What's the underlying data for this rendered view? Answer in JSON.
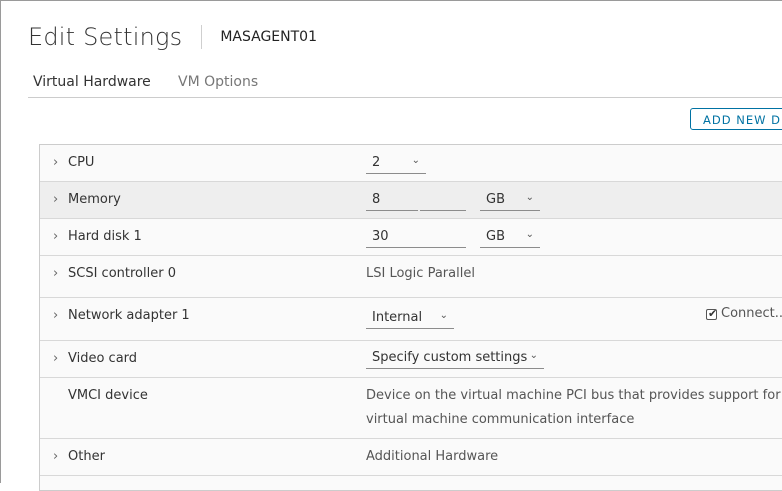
{
  "header": {
    "title": "Edit Settings",
    "vm_name": "MASAGENT01"
  },
  "tabs": [
    {
      "label": "Virtual Hardware",
      "active": true
    },
    {
      "label": "VM Options",
      "active": false
    }
  ],
  "toolbar": {
    "add_new_device_label": "ADD NEW DEVICE"
  },
  "hardware": {
    "cpu": {
      "label": "CPU",
      "value": "2"
    },
    "memory": {
      "label": "Memory",
      "value": "8",
      "unit": "GB"
    },
    "hard_disk": {
      "label": "Hard disk 1",
      "value": "30",
      "unit": "GB"
    },
    "scsi": {
      "label": "SCSI controller 0",
      "value": "LSI Logic Parallel"
    },
    "network": {
      "label": "Network adapter 1",
      "value": "Internal",
      "connect_label": "Connect...",
      "connected": true
    },
    "video": {
      "label": "Video card",
      "value": "Specify custom settings"
    },
    "vmci": {
      "label": "VMCI device",
      "description_line1": "Device on the virtual machine PCI bus that provides support for the",
      "description_line2": "virtual machine communication interface"
    },
    "other": {
      "label": "Other",
      "value": "Additional Hardware"
    }
  },
  "icons": {
    "expand": "chevron-right-icon",
    "dropdown": "chevron-down-icon",
    "check": "checkmark-icon"
  },
  "colors": {
    "accent": "#0072a3",
    "row_alt": "#eeeeee",
    "grid_bg": "#fafafa"
  }
}
